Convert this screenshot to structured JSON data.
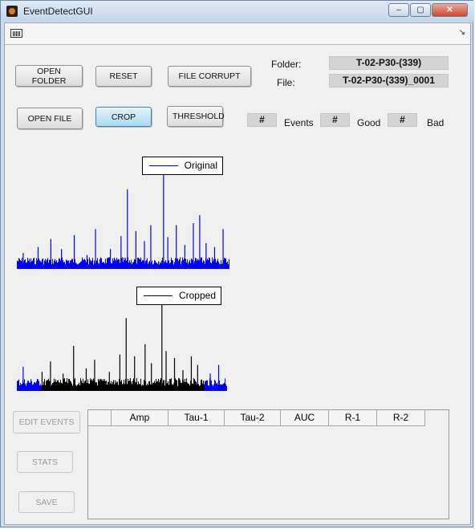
{
  "window": {
    "title": "EventDetectGUI",
    "controls": {
      "minimize": "–",
      "maximize": "▢",
      "close": "✕"
    }
  },
  "toolbar": {
    "icon": "plot-icon",
    "corner_icon": "↘"
  },
  "buttons": {
    "open_folder": "OPEN FOLDER",
    "reset": "RESET",
    "file_corrupt": "FILE CORRUPT",
    "open_file": "OPEN FILE",
    "crop": "CROP",
    "threshold": "THRESHOLD",
    "edit_events": "EDIT EVENTS",
    "stats": "STATS",
    "save": "SAVE"
  },
  "info": {
    "folder_label": "Folder:",
    "folder_value": "T-02-P30-(339)",
    "file_label": "File:",
    "file_value": "T-02-P30-(339)_0001"
  },
  "counts": {
    "events_value": "#",
    "events_label": "Events",
    "good_value": "#",
    "good_label": "Good",
    "bad_value": "#",
    "bad_label": "Bad"
  },
  "colors": {
    "original": "#0000ff",
    "cropped": "#000000",
    "button_active": "#a8d8f1"
  },
  "chart_data": [
    {
      "type": "line",
      "series": [
        {
          "name": "Original",
          "color": "#0000ff",
          "spikes": [
            {
              "x": 0.03,
              "y": 0.16
            },
            {
              "x": 0.1,
              "y": 0.22
            },
            {
              "x": 0.16,
              "y": 0.3
            },
            {
              "x": 0.21,
              "y": 0.2
            },
            {
              "x": 0.27,
              "y": 0.34
            },
            {
              "x": 0.33,
              "y": 0.14
            },
            {
              "x": 0.37,
              "y": 0.4
            },
            {
              "x": 0.44,
              "y": 0.2
            },
            {
              "x": 0.49,
              "y": 0.33
            },
            {
              "x": 0.52,
              "y": 0.8
            },
            {
              "x": 0.56,
              "y": 0.38
            },
            {
              "x": 0.6,
              "y": 0.28
            },
            {
              "x": 0.63,
              "y": 0.44
            },
            {
              "x": 0.69,
              "y": 1.0
            },
            {
              "x": 0.71,
              "y": 0.32
            },
            {
              "x": 0.75,
              "y": 0.44
            },
            {
              "x": 0.79,
              "y": 0.24
            },
            {
              "x": 0.83,
              "y": 0.46
            },
            {
              "x": 0.86,
              "y": 0.54
            },
            {
              "x": 0.89,
              "y": 0.26
            },
            {
              "x": 0.93,
              "y": 0.22
            },
            {
              "x": 0.97,
              "y": 0.4
            }
          ]
        }
      ]
    },
    {
      "type": "line",
      "crop_range": [
        0.12,
        0.89
      ],
      "series": [
        {
          "name": "Cropped",
          "color": "#000000",
          "spikes": [
            {
              "x": 0.03,
              "y": 0.28
            },
            {
              "x": 0.12,
              "y": 0.22
            },
            {
              "x": 0.16,
              "y": 0.34
            },
            {
              "x": 0.22,
              "y": 0.2
            },
            {
              "x": 0.27,
              "y": 0.52
            },
            {
              "x": 0.33,
              "y": 0.26
            },
            {
              "x": 0.37,
              "y": 0.36
            },
            {
              "x": 0.44,
              "y": 0.22
            },
            {
              "x": 0.49,
              "y": 0.42
            },
            {
              "x": 0.52,
              "y": 0.84
            },
            {
              "x": 0.56,
              "y": 0.4
            },
            {
              "x": 0.61,
              "y": 0.54
            },
            {
              "x": 0.64,
              "y": 0.32
            },
            {
              "x": 0.69,
              "y": 1.0
            },
            {
              "x": 0.71,
              "y": 0.46
            },
            {
              "x": 0.75,
              "y": 0.38
            },
            {
              "x": 0.79,
              "y": 0.24
            },
            {
              "x": 0.83,
              "y": 0.4
            },
            {
              "x": 0.86,
              "y": 0.3
            },
            {
              "x": 0.92,
              "y": 0.2
            },
            {
              "x": 0.96,
              "y": 0.3
            }
          ]
        }
      ]
    }
  ],
  "table": {
    "columns": [
      "",
      "Amp",
      "Tau-1",
      "Tau-2",
      "AUC",
      "R-1",
      "R-2"
    ],
    "rows": []
  }
}
